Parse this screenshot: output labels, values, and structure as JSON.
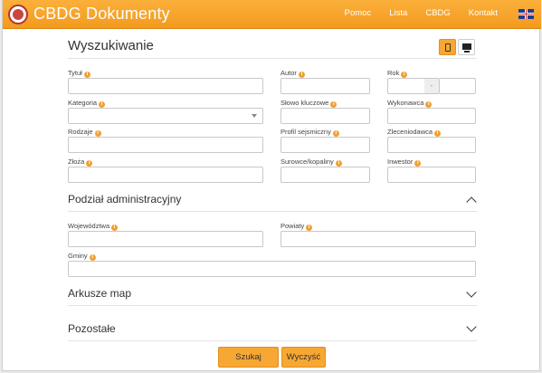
{
  "navbar": {
    "brand": "CBDG Dokumenty",
    "links": [
      "Pomoc",
      "Lista",
      "CBDG",
      "Kontakt"
    ],
    "flag_icon": "uk-flag-icon",
    "accent": "#f7a733"
  },
  "page": {
    "title": "Wyszukiwanie"
  },
  "view_toggle": {
    "icons": [
      "tablet-icon",
      "desktop-icon"
    ],
    "active": "tablet-icon"
  },
  "fields": {
    "tytul": "Tytuł",
    "kategoria": "Kategoria",
    "rodzaje": "Rodzaje",
    "zloza": "Złoża",
    "autor": "Autor",
    "slowo": "Słowo kluczowe",
    "profil": "Profil sejsmiczny",
    "surowce": "Surowce/kopaliny",
    "rok": "Rok",
    "rok_separator": "-",
    "wykonawca": "Wykonawca",
    "zleceniodawca": "Zleceniodawca",
    "inwestor": "Inwestor"
  },
  "sections": {
    "podzial": {
      "title": "Podział administracyjny",
      "expanded": true
    },
    "wojewodztwa": "Województwa",
    "powiaty": "Powiaty",
    "gminy": "Gminy",
    "arkusze": {
      "title": "Arkusze map",
      "expanded": false
    },
    "pozostale": {
      "title": "Pozostałe",
      "expanded": false
    }
  },
  "buttons": {
    "search": "Szukaj",
    "clear": "Wyczyść"
  }
}
